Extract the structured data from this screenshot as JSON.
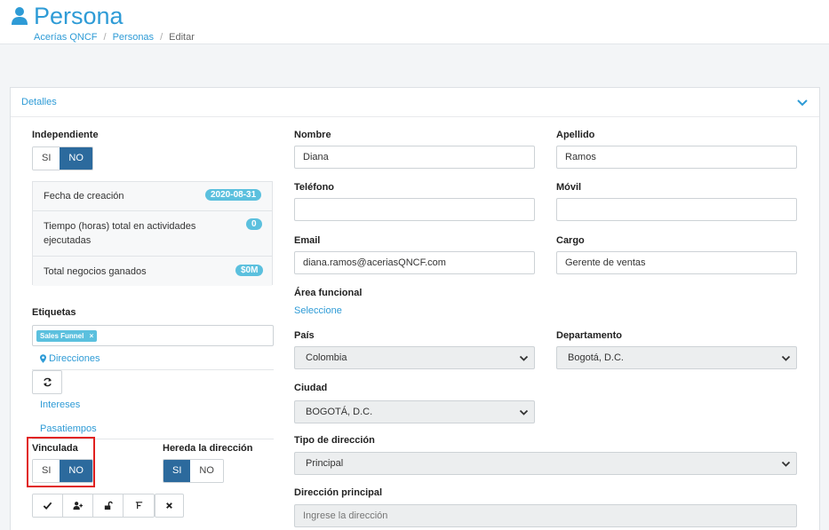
{
  "header": {
    "title": "Persona",
    "icon": "user-icon",
    "breadcrumb": [
      "Acerías QNCF",
      "Personas",
      "Editar"
    ],
    "breadcrumb_sep": "/"
  },
  "panel": {
    "title": "Detalles"
  },
  "left": {
    "independiente_label": "Independiente",
    "independiente_yes": "SI",
    "independiente_no": "NO",
    "independiente_selected": "NO",
    "info": [
      {
        "label": "Fecha de creación",
        "badge": "2020-08-31"
      },
      {
        "label": "Tiempo (horas) total en actividades ejecutadas",
        "badge": "0"
      },
      {
        "label": "Total negocios ganados",
        "badge": "$0M"
      }
    ],
    "etiquetas_label": "Etiquetas",
    "tag": "Sales Funnel",
    "tag_remove": "×",
    "direcciones_link": "Direcciones",
    "intereses_link": "Intereses",
    "pasatiempos_link": "Pasatiempos",
    "vinculada_label": "Vinculada",
    "vinculada_yes": "SI",
    "vinculada_no": "NO",
    "hereda_label": "Hereda la dirección",
    "hereda_yes": "SI",
    "hereda_no": "NO"
  },
  "form": {
    "nombre_label": "Nombre",
    "nombre_value": "Diana",
    "apellido_label": "Apellido",
    "apellido_value": "Ramos",
    "telefono_label": "Teléfono",
    "telefono_value": "",
    "movil_label": "Móvil",
    "movil_value": "",
    "email_label": "Email",
    "email_value": "diana.ramos@aceriasQNCF.com",
    "cargo_label": "Cargo",
    "cargo_value": "Gerente de ventas",
    "area_label": "Área funcional",
    "area_link": "Seleccione",
    "pais_label": "País",
    "pais_value": "Colombia",
    "departamento_label": "Departamento",
    "departamento_value": "Bogotá, D.C.",
    "ciudad_label": "Ciudad",
    "ciudad_value": "BOGOTÁ, D.C.",
    "tipo_dir_label": "Tipo de dirección",
    "tipo_dir_value": "Principal",
    "dir_principal_label": "Dirección principal",
    "dir_principal_placeholder": "Ingrese la dirección"
  },
  "colors": {
    "accent": "#2e9bd6",
    "toggle_on": "#2c6a9d",
    "badge": "#5bc0de",
    "highlight": "#e0201f"
  }
}
